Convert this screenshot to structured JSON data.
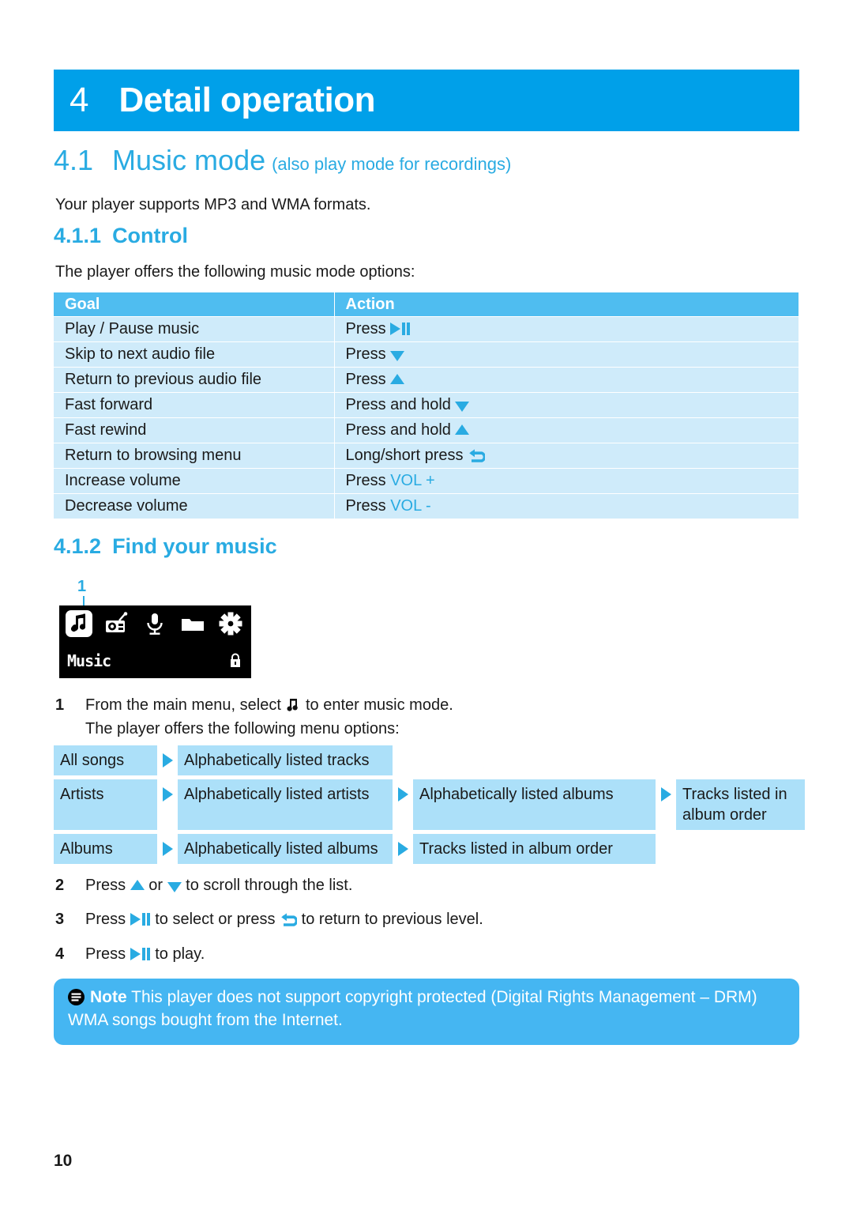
{
  "chapter": {
    "number": "4",
    "title": "Detail operation"
  },
  "section": {
    "number": "4.1",
    "title": "Music mode",
    "subtitle": "(also play mode for recordings)",
    "intro": "Your player supports MP3 and WMA formats."
  },
  "subsection_control": {
    "number": "4.1.1",
    "title": "Control",
    "lead": "The player offers the following music mode options:",
    "table": {
      "headers": [
        "Goal",
        "Action"
      ],
      "rows": [
        {
          "goal": "Play / Pause music",
          "action_prefix": "Press",
          "icon": "play-pause-icon",
          "action_suffix": ""
        },
        {
          "goal": "Skip to next audio file",
          "action_prefix": "Press",
          "icon": "down-arrow-icon",
          "action_suffix": ""
        },
        {
          "goal": "Return to previous audio file",
          "action_prefix": "Press",
          "icon": "up-arrow-icon",
          "action_suffix": ""
        },
        {
          "goal": "Fast forward",
          "action_prefix": "Press and hold",
          "icon": "down-arrow-icon",
          "action_suffix": ""
        },
        {
          "goal": "Fast rewind",
          "action_prefix": "Press and hold",
          "icon": "up-arrow-icon",
          "action_suffix": ""
        },
        {
          "goal": "Return to browsing menu",
          "action_prefix": "Long/short press",
          "icon": "back-arrow-icon",
          "action_suffix": ""
        },
        {
          "goal": "Increase volume",
          "action_prefix": "Press",
          "icon": "",
          "action_suffix": "VOL +"
        },
        {
          "goal": "Decrease volume",
          "action_prefix": "Press",
          "icon": "",
          "action_suffix": "VOL -"
        }
      ]
    }
  },
  "subsection_find": {
    "number": "4.1.2",
    "title": "Find your music",
    "callout": "1",
    "device": {
      "icons": [
        "music-note-icon",
        "radio-icon",
        "microphone-icon",
        "folder-icon",
        "gear-icon"
      ],
      "selected_index": 0,
      "label": "Music",
      "status_icon": "lock-icon"
    },
    "steps": [
      {
        "num": "1",
        "line1_a": "From the main menu, select",
        "line1_icon": "music-note-icon",
        "line1_b": "to enter music mode.",
        "line2": "The player offers the following menu options:"
      },
      {
        "num": "2",
        "a": "Press",
        "icon1": "up-arrow-icon",
        "b": "or",
        "icon2": "down-arrow-icon",
        "c": "to scroll through the list."
      },
      {
        "num": "3",
        "a": "Press",
        "icon1": "play-pause-icon",
        "b": "to select or press",
        "icon2": "back-arrow-icon",
        "c": "to return to previous level."
      },
      {
        "num": "4",
        "a": "Press",
        "icon1": "play-pause-icon",
        "b": "to play.",
        "icon2": "",
        "c": ""
      }
    ],
    "flow": {
      "rows": [
        {
          "cells": [
            "All songs",
            "Alphabetically listed tracks"
          ]
        },
        {
          "cells": [
            "Artists",
            "Alphabetically listed artists",
            "Alphabetically listed albums",
            "Tracks listed in album order"
          ]
        },
        {
          "cells": [
            "Albums",
            "Alphabetically listed albums",
            "Tracks listed in album order"
          ]
        }
      ]
    }
  },
  "note": {
    "icon": "note-icon",
    "label": "Note",
    "text": " This player does not support copyright protected (Digital Rights Management – DRM) WMA songs bought from the Internet."
  },
  "footer": {
    "page_number": "10"
  },
  "colors": {
    "chapter_bar": "#00A0E9",
    "heading_blue": "#29ABE2",
    "table_header": "#4FBDF0",
    "table_row": "#CFEBFA",
    "flow_box": "#ACE0F9",
    "note_box": "#45B6F2"
  }
}
